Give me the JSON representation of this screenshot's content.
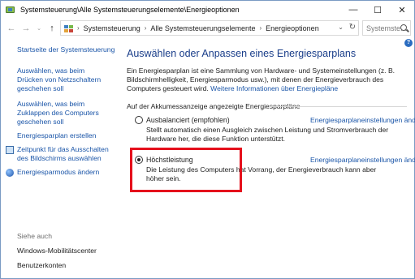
{
  "window": {
    "title": "Systemsteuerung\\Alle Systemsteuerungselemente\\Energieoptionen",
    "controls": [
      "—",
      "☐",
      "✕"
    ]
  },
  "address": {
    "crumbs": [
      "Systemsteuerung",
      "Alle Systemsteuerungselemente",
      "Energieoptionen"
    ],
    "search_placeholder": "Systemste..."
  },
  "sidebar": {
    "home_link": "Startseite der Systemsteuerung",
    "links": [
      "Auswählen, was beim Drücken von Netzschaltern geschehen soll",
      "Auswählen, was beim Zuklappen des Computers geschehen soll",
      "Energiesparplan erstellen",
      "Zeitpunkt für das Ausschalten des Bildschirms auswählen",
      "Energiesparmodus ändern"
    ],
    "see_also_label": "Siehe auch",
    "see_also_links": [
      "Windows-Mobilitätscenter",
      "Benutzerkonten"
    ]
  },
  "main": {
    "title": "Auswählen oder Anpassen eines Energiesparplans",
    "intro_text": "Ein Energiesparplan ist eine Sammlung von Hardware- und Systemeinstellungen (z. B. Bildschirmhelligkeit, Energiesparmodus usw.), mit denen der Energieverbrauch des Computers gesteuert wird.",
    "intro_link": "Weitere Informationen über Energiepläne",
    "group_label": "Auf der Akkumessanzeige angezeigte Energiesparpläne",
    "plans": [
      {
        "name": "Ausbalanciert (empfohlen)",
        "selected": false,
        "link": "Energiesparplaneinstellungen ändern",
        "description": "Stellt automatisch einen Ausgleich zwischen Leistung und Stromverbrauch der Hardware her, die diese Funktion unterstützt."
      },
      {
        "name": "Höchstleistung",
        "selected": true,
        "link": "Energiesparplaneinstellungen ändern",
        "description": "Die Leistung des Computers hat Vorrang, der Energieverbrauch kann aber höher sein."
      }
    ]
  },
  "annotation_color": "#e5101c"
}
